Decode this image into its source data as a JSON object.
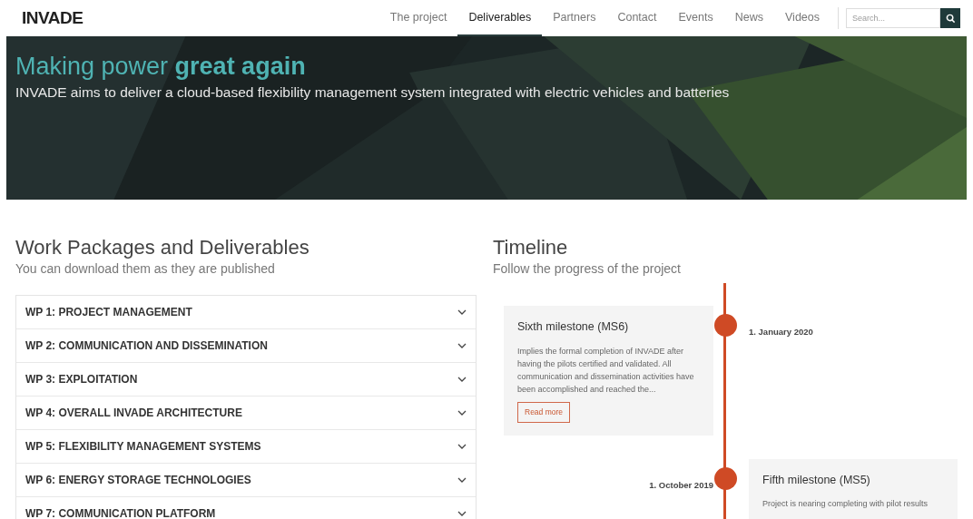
{
  "header": {
    "logo": "INVADE",
    "nav": [
      {
        "label": "The project",
        "selected": false
      },
      {
        "label": "Deliverables",
        "selected": true
      },
      {
        "label": "Partners",
        "selected": false
      },
      {
        "label": "Contact",
        "selected": false
      },
      {
        "label": "Events",
        "selected": false
      },
      {
        "label": "News",
        "selected": false
      },
      {
        "label": "Videos",
        "selected": false
      }
    ],
    "search": {
      "placeholder": "Search..."
    }
  },
  "hero": {
    "title": "Making power **great again**",
    "subtitle": "INVADE aims to deliver a cloud-based flexibility management system integrated with electric vehicles and batteries"
  },
  "work_packages": {
    "title": "Work Packages and Deliverables",
    "subtitle": "You can download them as they are published",
    "items": [
      {
        "label": "WP 1: PROJECT MANAGEMENT",
        "expanded": false
      },
      {
        "label": "WP 2: COMMUNICATION AND DISSEMINATION",
        "expanded": false
      },
      {
        "label": "WP 3: EXPLOITATION",
        "expanded": false
      },
      {
        "label": "WP 4: OVERALL INVADE ARCHITECTURE",
        "expanded": false
      },
      {
        "label": "WP 5: FLEXIBILITY MANAGEMENT SYSTEMS",
        "expanded": false
      },
      {
        "label": "WP 6: ENERGY STORAGE TECHNOLOGIES",
        "expanded": false
      },
      {
        "label": "WP 7: COMMUNICATION PLATFORM",
        "expanded": false
      }
    ]
  },
  "timeline": {
    "title": "Timeline",
    "subtitle": "Follow the progress of the project",
    "entries": [
      {
        "kind": "left",
        "date": "1. January 2020",
        "title": "Sixth milestone (MS6)",
        "text": "Implies the formal completion of INVADE after having the pilots certified and validated. All communication and dissemination activities have been accomplished and reached the...",
        "button": "Read more"
      },
      {
        "kind": "right",
        "date": "1. October 2019",
        "title": "Fifth milestone (MS5)",
        "text": "Project is nearing completing with pilot results"
      }
    ]
  }
}
